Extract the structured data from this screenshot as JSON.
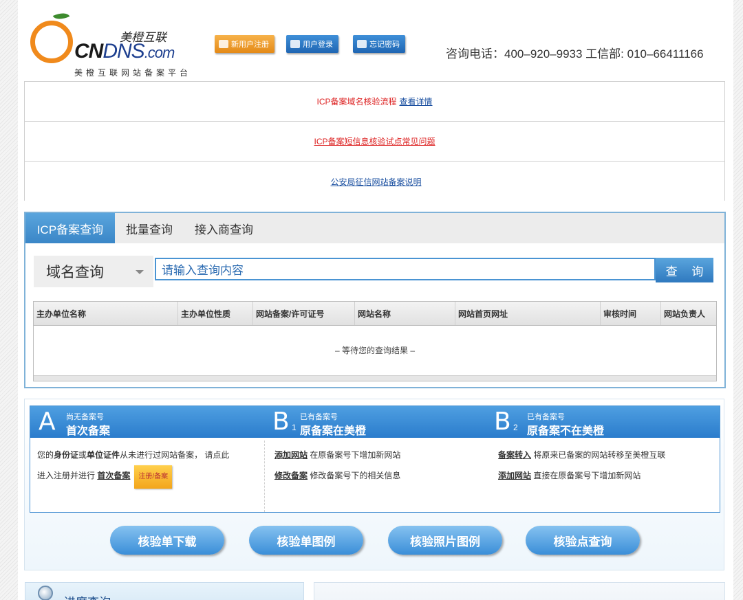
{
  "header": {
    "logo_cn_title": "美橙互联",
    "logo_brand_bold": "CN",
    "logo_brand_thin": "DNS",
    "logo_brand_suffix": ".com",
    "logo_subtitle": "美橙互联网站备案平台",
    "btn_register": "新用户注册",
    "btn_login": "用户登录",
    "btn_forgot": "忘记密码",
    "hotline": "咨询电话：400–920–9933 工信部: 010–66411166"
  },
  "notices": {
    "n1_text": "ICP备案域名核验流程",
    "n1_link": "查看详情",
    "n2_link": "ICP备案短信息核验试点常见问题",
    "n3_link": "公安局征信网站备案说明"
  },
  "query": {
    "tabs": [
      "ICP备案查询",
      "批量查询",
      "接入商查询"
    ],
    "select_value": "域名查询",
    "search_placeholder": "请输入查询内容",
    "search_button": "查 询",
    "columns": [
      "主办单位名称",
      "主办单位性质",
      "网站备案/许可证号",
      "网站名称",
      "网站首页网址",
      "审核时间",
      "网站负责人"
    ],
    "empty_text": "– 等待您的查询结果 –"
  },
  "filing": {
    "a": {
      "letter": "A",
      "small": "尚无备案号",
      "title": "首次备案",
      "line1_pre": "您的",
      "line1_b1": "身份证",
      "line1_mid": "或",
      "line1_b2": "单位证件",
      "line1_post": "从未进行过网站备案， 请点此",
      "line2_pre": "进入注册并进行",
      "line2_link": "首次备案",
      "reg_btn": "注册/备案"
    },
    "b1": {
      "letter": "B",
      "num": "1",
      "small": "已有备案号",
      "title": "原备案在美橙",
      "link1": "添加网站",
      "text1": "在原备案号下增加新网站",
      "link2": "修改备案",
      "text2": "修改备案号下的相关信息"
    },
    "b2": {
      "letter": "B",
      "num": "2",
      "small": "已有备案号",
      "title": "原备案不在美橙",
      "link1": "备案转入",
      "text1": "将原来已备案的网站转移至美橙互联",
      "link2": "添加网站",
      "text2": "直接在原备案号下增加新网站"
    },
    "buttons": [
      "核验单下载",
      "核验单图例",
      "核验照片图例",
      "核验点查询"
    ]
  },
  "bottom": {
    "progress_title": "进度查询"
  }
}
